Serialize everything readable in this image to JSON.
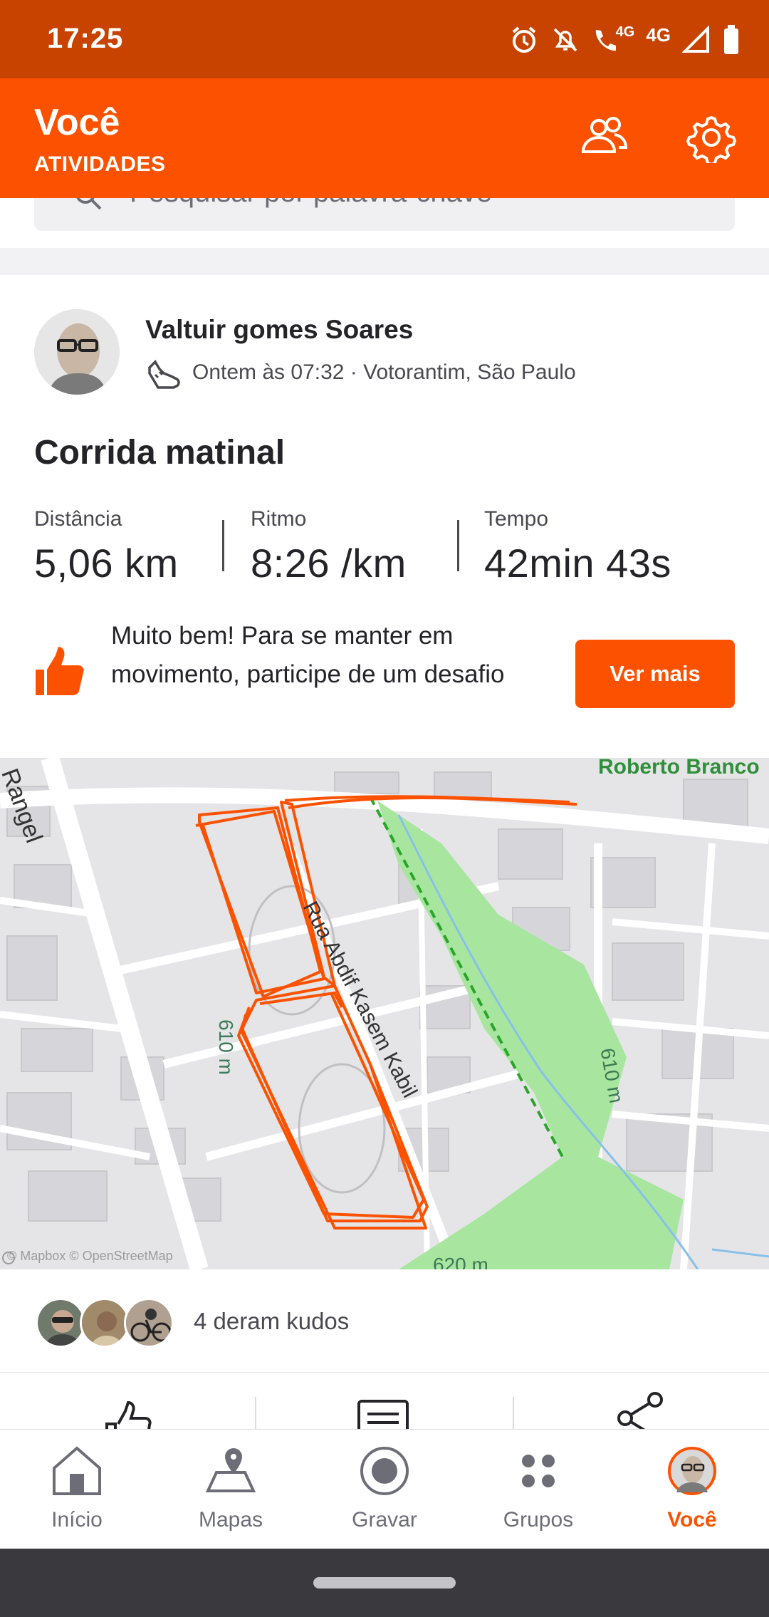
{
  "status_bar": {
    "time": "17:25",
    "network_labels": [
      "4G",
      "4G"
    ],
    "icons": [
      "alarm-icon",
      "mute-icon",
      "wifi-call-icon",
      "signal-icon",
      "battery-icon"
    ]
  },
  "header": {
    "title": "Você",
    "subtitle": "ATIVIDADES",
    "icons": [
      "friends-icon",
      "settings-icon"
    ],
    "color": "#fc5200"
  },
  "search": {
    "placeholder": "Pesquisar por palavra-chave"
  },
  "activity": {
    "athlete_name": "Valtuir gomes Soares",
    "meta": "Ontem às 07:32 · Votorantim, São Paulo",
    "activity_icon": "running-shoe-icon",
    "title": "Corrida matinal",
    "stats": [
      {
        "label": "Distância",
        "value": "5,06 km"
      },
      {
        "label": "Ritmo",
        "value": "8:26 /km"
      },
      {
        "label": "Tempo",
        "value": "42min 43s"
      }
    ],
    "promo_text": "Muito bem! Para se manter em movimento, participe de um desafio",
    "promo_button": "Ver mais"
  },
  "map": {
    "labels": {
      "top_right": "Roberto Branco",
      "street_left": "Rangel",
      "street_mid": "Rua Abdif Kasem Kabil",
      "elevation_left": "610 m",
      "elevation_right": "610 m",
      "elevation_bottom": "620 m",
      "credit": "© Mapbox © OpenStreetMap"
    },
    "route_color": "#fc5200",
    "park_color": "#a8e6a0"
  },
  "kudos": {
    "text": "4 deram kudos",
    "avatar_count": 3
  },
  "actions": [
    "kudos-icon",
    "comment-icon",
    "share-icon"
  ],
  "bottom_nav": {
    "items": [
      {
        "label": "Início",
        "icon": "home-icon",
        "active": false
      },
      {
        "label": "Mapas",
        "icon": "maps-icon",
        "active": false
      },
      {
        "label": "Gravar",
        "icon": "record-icon",
        "active": false
      },
      {
        "label": "Grupos",
        "icon": "groups-icon",
        "active": false
      },
      {
        "label": "Você",
        "icon": "profile-avatar-icon",
        "active": true
      }
    ]
  }
}
